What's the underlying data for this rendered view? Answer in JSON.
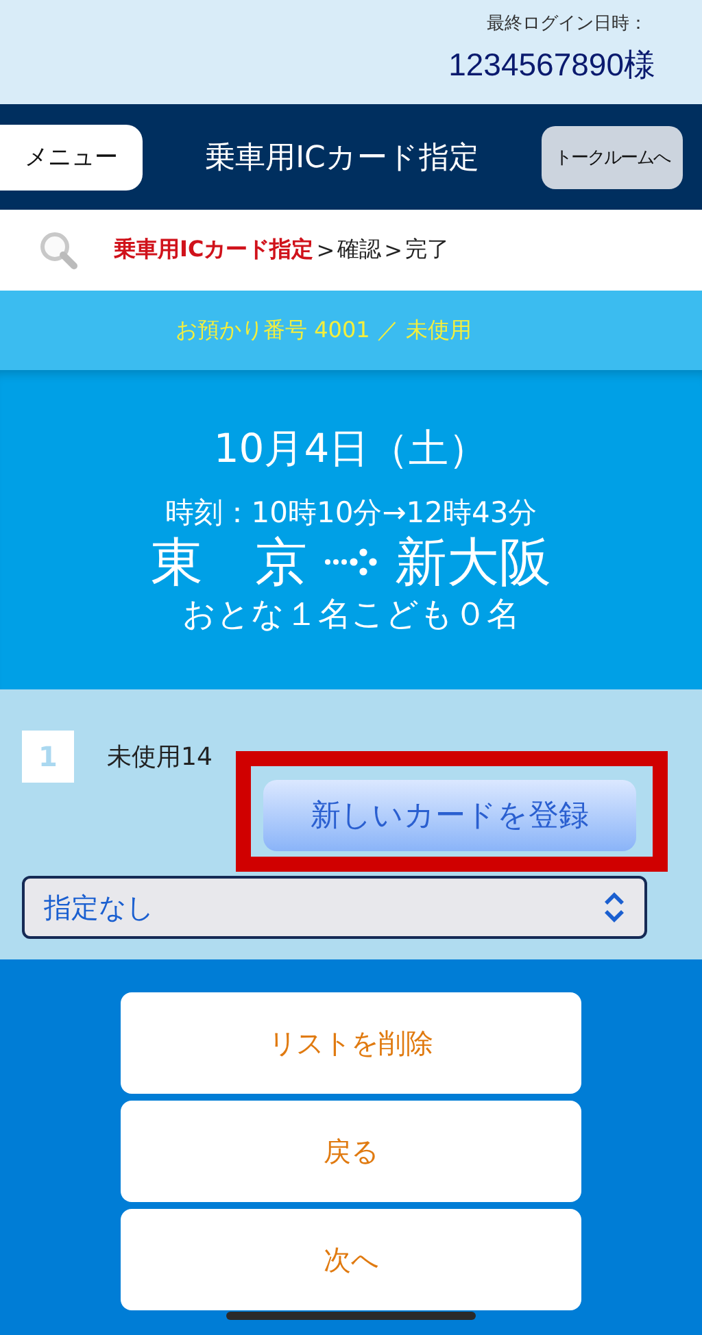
{
  "header": {
    "last_login_label": "最終ログイン日時：",
    "user": "1234567890様"
  },
  "nav": {
    "menu_button": "メニュー",
    "title": "乗車用ICカード指定",
    "talk_button": "トークルームへ"
  },
  "breadcrumb": {
    "separator": ">",
    "steps": [
      {
        "label": "乗車用ICカード指定",
        "selected": true
      },
      {
        "label": "確認",
        "selected": false
      },
      {
        "label": "完了",
        "selected": false
      }
    ]
  },
  "reservation": {
    "number_line": "お預かり番号 4001 ／ 未使用"
  },
  "trip": {
    "date": "10月4日（土）",
    "time": "時刻：10時10分→12時43分",
    "from": "東　京",
    "to": "新大阪",
    "passengers": "おとな１名こども０名"
  },
  "seat": {
    "index": "1",
    "label": "未使用14",
    "register_button": "新しいカードを登録",
    "highlighted": true,
    "select_value": "指定なし"
  },
  "buttons": [
    "リストを削除",
    "戻る",
    "次へ"
  ]
}
